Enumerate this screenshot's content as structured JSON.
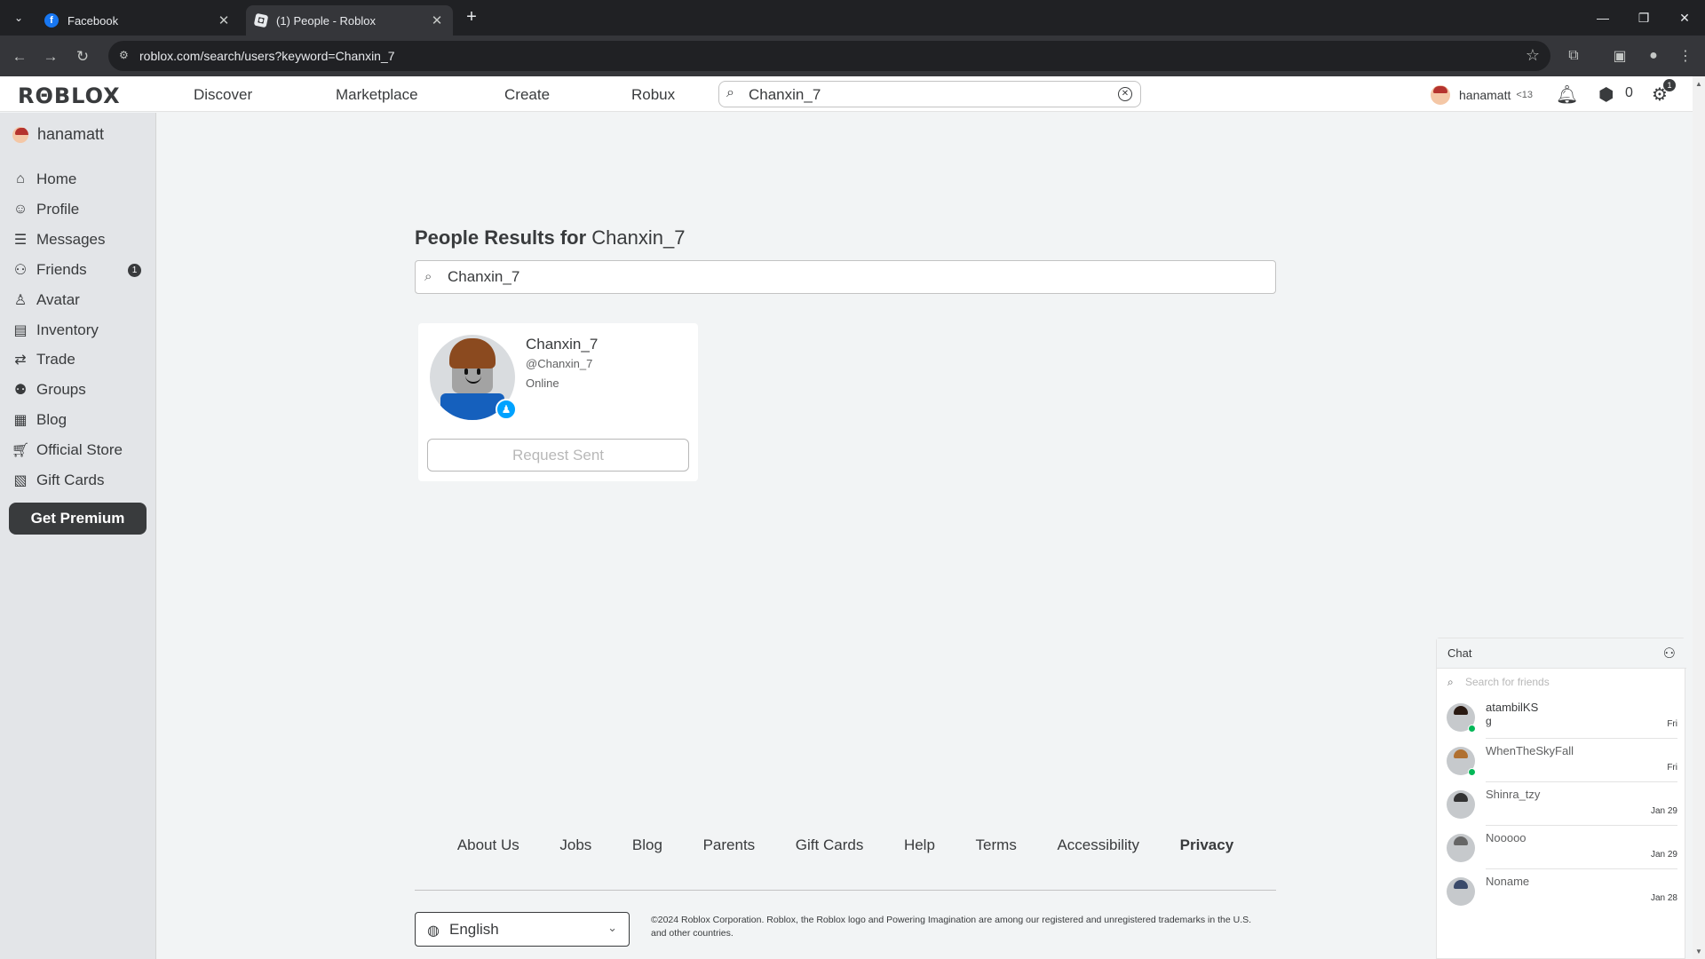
{
  "browser": {
    "tabs": [
      {
        "title": "Facebook",
        "favicon": "facebook-icon",
        "active": false
      },
      {
        "title": "(1) People - Roblox",
        "favicon": "roblox-icon",
        "active": true
      }
    ],
    "url": "roblox.com/search/users?keyword=Chanxin_7"
  },
  "header": {
    "logo": "RΘBLOX",
    "nav": [
      "Discover",
      "Marketplace",
      "Create",
      "Robux"
    ],
    "search_value": "Chanxin_7",
    "username": "hanamatt",
    "age_label": "<13",
    "robux": "0",
    "settings_badge": "1"
  },
  "sidebar": {
    "username": "hanamatt",
    "items": [
      {
        "label": "Home",
        "icon": "home-icon"
      },
      {
        "label": "Profile",
        "icon": "profile-icon"
      },
      {
        "label": "Messages",
        "icon": "messages-icon"
      },
      {
        "label": "Friends",
        "icon": "friends-icon",
        "badge": "1"
      },
      {
        "label": "Avatar",
        "icon": "avatar-icon"
      },
      {
        "label": "Inventory",
        "icon": "inventory-icon"
      },
      {
        "label": "Trade",
        "icon": "trade-icon"
      },
      {
        "label": "Groups",
        "icon": "groups-icon"
      },
      {
        "label": "Blog",
        "icon": "blog-icon"
      },
      {
        "label": "Official Store",
        "icon": "store-icon"
      },
      {
        "label": "Gift Cards",
        "icon": "gift-card-icon"
      }
    ],
    "premium_label": "Get Premium"
  },
  "results": {
    "title_prefix": "People Results for",
    "keyword": "Chanxin_7",
    "search_value": "Chanxin_7",
    "card": {
      "name": "Chanxin_7",
      "handle": "@Chanxin_7",
      "status": "Online",
      "button": "Request Sent"
    }
  },
  "footer": {
    "links": [
      "About Us",
      "Jobs",
      "Blog",
      "Parents",
      "Gift Cards",
      "Help",
      "Terms",
      "Accessibility",
      "Privacy"
    ],
    "language": "English",
    "copyright": "©2024 Roblox Corporation. Roblox, the Roblox logo and Powering Imagination are among our registered and unregistered trademarks in the U.S. and other countries."
  },
  "chat": {
    "title": "Chat",
    "search_placeholder": "Search for friends",
    "conversations": [
      {
        "name": "atambilKS",
        "message": "g",
        "date": "Fri",
        "online": true
      },
      {
        "name": "WhenTheSkyFall",
        "message": "",
        "date": "Fri",
        "online": true
      },
      {
        "name": "Shinra_tzy",
        "message": "",
        "date": "Jan 29",
        "online": false
      },
      {
        "name": "Nooooo",
        "message": "",
        "date": "Jan 29",
        "online": false
      },
      {
        "name": "Noname",
        "message": "",
        "date": "Jan 28",
        "online": false
      }
    ]
  },
  "colors": {
    "accent_blue": "#00a2ff",
    "online_green": "#02b757",
    "dark": "#393b3d"
  }
}
